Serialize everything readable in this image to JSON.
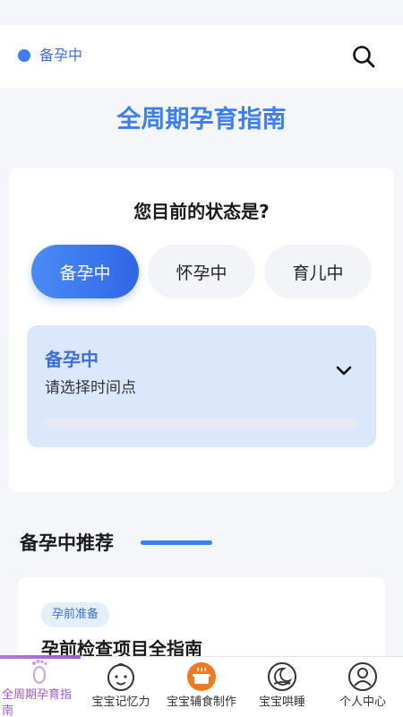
{
  "header": {
    "status_label": "备孕中"
  },
  "page_title": "全周期孕育指南",
  "status_card": {
    "question": "您目前的状态是?",
    "options": [
      "备孕中",
      "怀孕中",
      "育儿中"
    ],
    "selected_index": 0,
    "stage_title": "备孕中",
    "stage_hint": "请选择时间点"
  },
  "recommend": {
    "title": "备孕中推荐",
    "articles": [
      {
        "tag": "孕前准备",
        "title": "孕前检查项目全指南"
      }
    ]
  },
  "tabbar": {
    "items": [
      {
        "label": "全周期孕育指南",
        "icon": "footprint-icon",
        "active": true
      },
      {
        "label": "宝宝记忆力",
        "icon": "baby-face-icon",
        "active": false
      },
      {
        "label": "宝宝辅食制作",
        "icon": "cooking-pot-icon",
        "active": false
      },
      {
        "label": "宝宝哄睡",
        "icon": "sleeping-moon-icon",
        "active": false
      },
      {
        "label": "个人中心",
        "icon": "user-icon",
        "active": false
      }
    ]
  },
  "colors": {
    "accent": "#3d7ef0",
    "active_tab": "#a057d0",
    "food_icon": "#f07a1c"
  }
}
